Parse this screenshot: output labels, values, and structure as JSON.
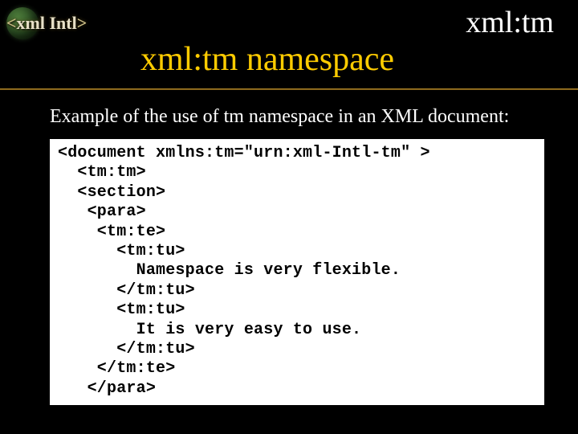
{
  "header": {
    "logo_text": "xml Intl",
    "tagline": "xml:tm",
    "title": "xml:tm namespace"
  },
  "body": {
    "intro": "Example of the use of tm namespace in an XML document:",
    "code": "<document xmlns:tm=\"urn:xml-Intl-tm\" >\n  <tm:tm>\n  <section>\n   <para>\n    <tm:te>\n      <tm:tu>\n        Namespace is very flexible.\n      </tm:tu>\n      <tm:tu>\n        It is very easy to use.\n      </tm:tu>\n    </tm:te>\n   </para>"
  },
  "colors": {
    "accent": "#ffcc00",
    "divider": "#b38a2a"
  }
}
